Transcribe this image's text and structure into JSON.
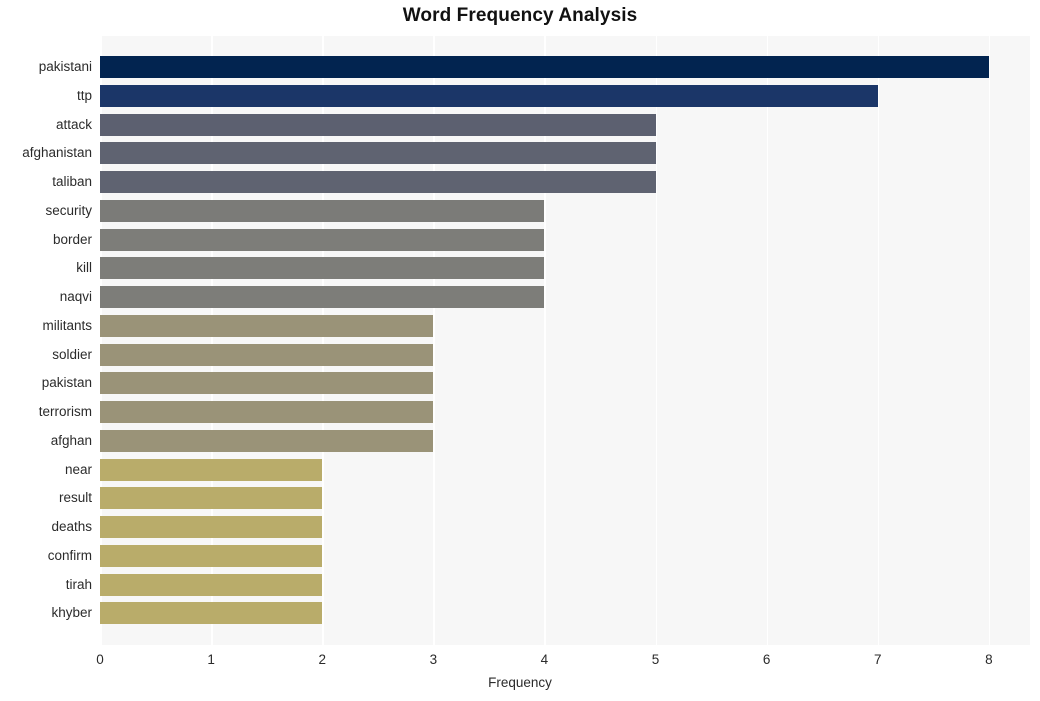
{
  "chart_data": {
    "type": "bar",
    "orientation": "horizontal",
    "title": "Word Frequency Analysis",
    "xlabel": "Frequency",
    "ylabel": "",
    "categories": [
      "pakistani",
      "ttp",
      "attack",
      "afghanistan",
      "taliban",
      "security",
      "border",
      "kill",
      "naqvi",
      "militants",
      "soldier",
      "pakistan",
      "terrorism",
      "afghan",
      "near",
      "result",
      "deaths",
      "confirm",
      "tirah",
      "khyber"
    ],
    "values": [
      8,
      7,
      5,
      5,
      5,
      4,
      4,
      4,
      4,
      3,
      3,
      3,
      3,
      3,
      2,
      2,
      2,
      2,
      2,
      2
    ],
    "xlim": [
      0,
      8.37
    ],
    "xticks": [
      0,
      1,
      2,
      3,
      4,
      5,
      6,
      7,
      8
    ],
    "xtick_labels": [
      "0",
      "1",
      "2",
      "3",
      "4",
      "5",
      "6",
      "7",
      "8"
    ],
    "grid": "vertical-white-on-gray",
    "legend": "none",
    "bar_colors": [
      "#022450",
      "#1b3668",
      "#5c6070",
      "#5f6371",
      "#5f6371",
      "#7b7b78",
      "#7d7d79",
      "#7d7d79",
      "#7d7d79",
      "#9a9378",
      "#9a9378",
      "#9a9378",
      "#9a9378",
      "#9a9378",
      "#b9ac6a",
      "#b9ac6a",
      "#b9ac6a",
      "#b9ac6a",
      "#b9ac6a",
      "#b9ac6a"
    ],
    "plot_background": "#f7f7f7",
    "figure_background": "#ffffff"
  }
}
